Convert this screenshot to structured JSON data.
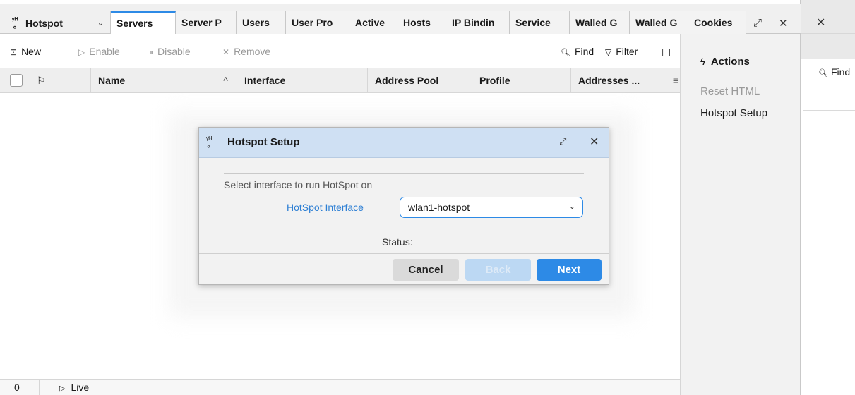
{
  "app": {
    "title": "Hotspot",
    "title_glyph": "ᵞᴴ\n∘"
  },
  "tabs": [
    {
      "label": "Servers",
      "active": true
    },
    {
      "label": "Server P"
    },
    {
      "label": "Users"
    },
    {
      "label": "User Pro"
    },
    {
      "label": "Active"
    },
    {
      "label": "Hosts"
    },
    {
      "label": "IP Bindin"
    },
    {
      "label": "Service"
    },
    {
      "label": "Walled G"
    },
    {
      "label": "Walled G"
    },
    {
      "label": "Cookies"
    }
  ],
  "toolbar": {
    "new_label": "New",
    "enable_label": "Enable",
    "disable_label": "Disable",
    "remove_label": "Remove",
    "find_label": "Find",
    "filter_label": "Filter"
  },
  "columns": {
    "flag": "⚐",
    "name": "Name",
    "sort": "^",
    "interface": "Interface",
    "address_pool": "Address Pool",
    "profile": "Profile",
    "addresses": "Addresses ...",
    "menu": "≡"
  },
  "status_bar": {
    "count": "0",
    "live": "Live"
  },
  "side_panel": {
    "title": "Actions",
    "items": [
      {
        "label": "Reset HTML",
        "enabled": false
      },
      {
        "label": "Hotspot Setup",
        "enabled": true
      }
    ]
  },
  "dialog": {
    "title": "Hotspot Setup",
    "instruction": "Select interface to run HotSpot on",
    "interface_label": "HotSpot Interface",
    "interface_value": "wlan1-hotspot",
    "status_label": "Status:",
    "cancel_label": "Cancel",
    "back_label": "Back",
    "next_label": "Next"
  },
  "background_window": {
    "find_label": "Find"
  },
  "colors": {
    "accent": "#2d8ae6",
    "dialog_title_bg": "#cfe0f3",
    "disabled_text": "#9a9a9a"
  }
}
